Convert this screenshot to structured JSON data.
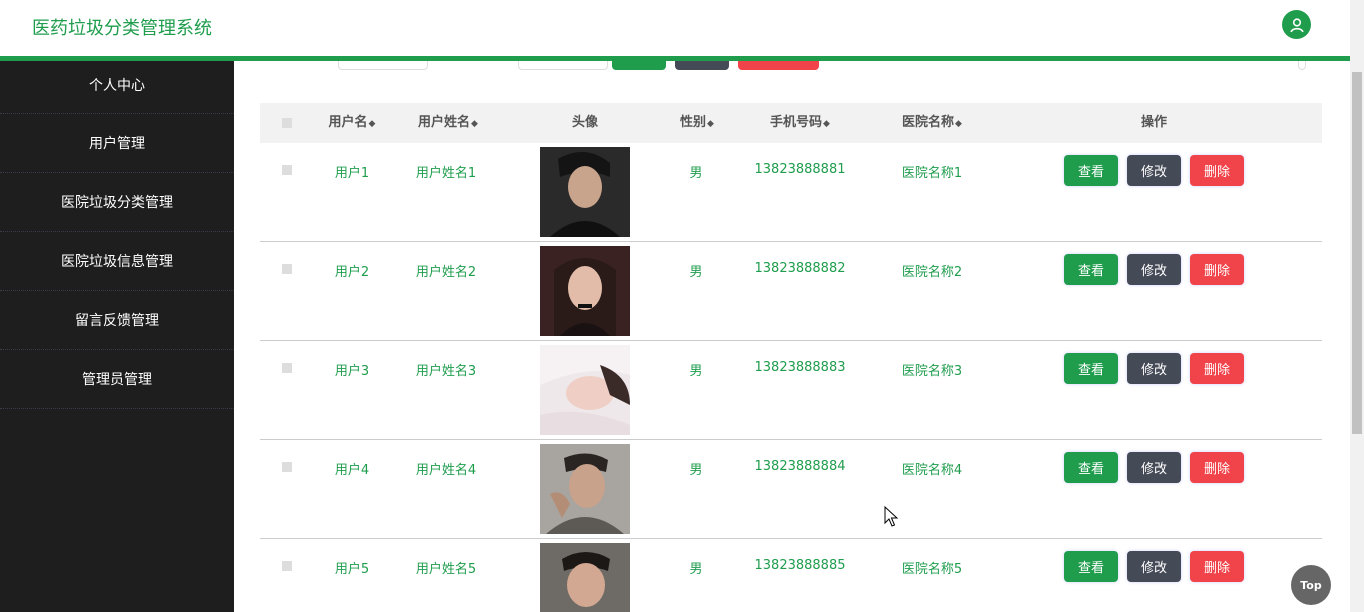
{
  "header": {
    "title": "医药垃圾分类管理系统",
    "avatar_icon": "user-icon"
  },
  "sidebar": {
    "items": [
      {
        "label": "个人中心"
      },
      {
        "label": "用户管理"
      },
      {
        "label": "医院垃圾分类管理"
      },
      {
        "label": "医院垃圾信息管理"
      },
      {
        "label": "留言反馈管理"
      },
      {
        "label": "管理员管理"
      }
    ]
  },
  "table": {
    "columns": {
      "username": "用户名",
      "name": "用户姓名",
      "avatar": "头像",
      "gender": "性别",
      "phone": "手机号码",
      "hospital": "医院名称",
      "actions": "操作"
    },
    "sort_icon": "◆",
    "buttons": {
      "view": "查看",
      "edit": "修改",
      "delete": "删除"
    },
    "rows": [
      {
        "username": "用户1",
        "name": "用户姓名1",
        "gender": "男",
        "phone": "13823888881",
        "hospital": "医院名称1"
      },
      {
        "username": "用户2",
        "name": "用户姓名2",
        "gender": "男",
        "phone": "13823888882",
        "hospital": "医院名称2"
      },
      {
        "username": "用户3",
        "name": "用户姓名3",
        "gender": "男",
        "phone": "13823888883",
        "hospital": "医院名称3"
      },
      {
        "username": "用户4",
        "name": "用户姓名4",
        "gender": "男",
        "phone": "13823888884",
        "hospital": "医院名称4"
      },
      {
        "username": "用户5",
        "name": "用户姓名5",
        "gender": "男",
        "phone": "13823888885",
        "hospital": "医院名称5"
      }
    ]
  },
  "top_button": "Top",
  "colors": {
    "brand": "#1f9d4d",
    "dark_button": "#454a57",
    "danger": "#f0444a",
    "sidebar": "#1e1e1e"
  }
}
